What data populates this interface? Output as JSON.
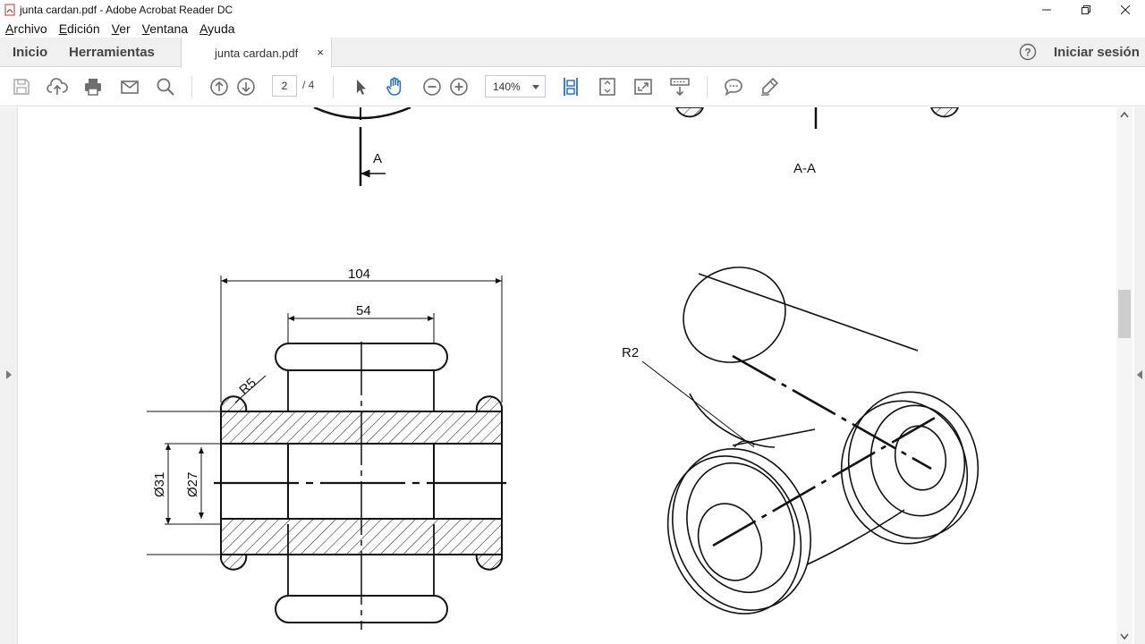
{
  "window": {
    "title": "junta cardan.pdf - Adobe Acrobat Reader DC",
    "controls": [
      "minimize-icon",
      "restore-icon",
      "close-icon"
    ]
  },
  "menu": [
    "Archivo",
    "Edición",
    "Ver",
    "Ventana",
    "Ayuda"
  ],
  "tabs": {
    "home": "Inicio",
    "tools": "Herramientas",
    "document": "junta cardan.pdf",
    "close": "×",
    "sign_in": "Iniciar sesión"
  },
  "toolbar": {
    "icons": [
      "save-icon",
      "upload-icon",
      "print-icon",
      "email-icon",
      "search-icon",
      "page-up-icon",
      "page-down-icon",
      "select-icon",
      "hand-icon",
      "zoom-out-icon",
      "zoom-in-icon",
      "fit-width-icon",
      "fit-page-icon",
      "fullscreen-icon",
      "scroll-mode-icon",
      "comment-icon",
      "sign-icon"
    ],
    "page_current": "2",
    "page_total": "/ 4",
    "zoom": "140%"
  },
  "drawing": {
    "section_marker": "A",
    "section_title": "A-A",
    "dim_overall": "104",
    "dim_center": "54",
    "radius_fillet": "R5",
    "diameter_outer": "Ø31",
    "diameter_inner": "Ø27",
    "radius_iso": "R2"
  },
  "colors": {
    "accent": "#2672c5",
    "toolbar_icon": "#6e6e6e",
    "tab_background": "#f0f0f0"
  }
}
